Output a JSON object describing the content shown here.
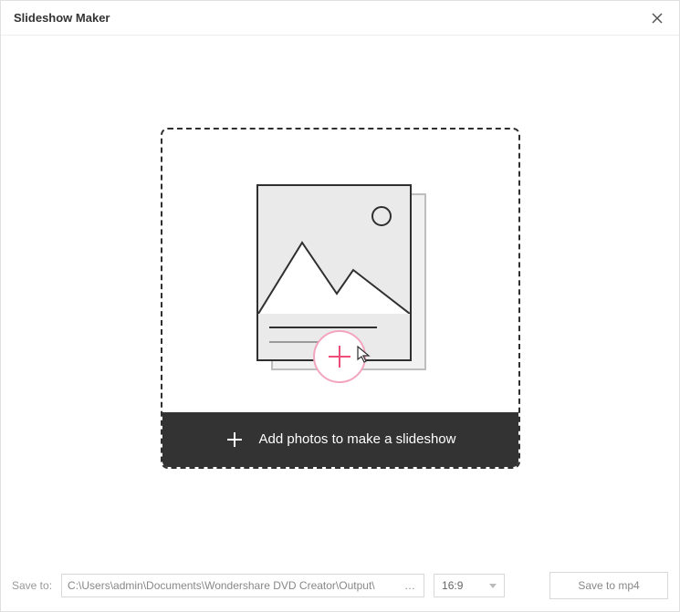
{
  "header": {
    "title": "Slideshow Maker"
  },
  "dropzone": {
    "bar_label": "Add photos to make a slideshow"
  },
  "footer": {
    "save_to_label": "Save to:",
    "path": "C:\\Users\\admin\\Documents\\Wondershare DVD Creator\\Output\\",
    "browse_ellipsis": "…",
    "aspect_ratio": "16:9",
    "save_button_label": "Save to mp4"
  }
}
